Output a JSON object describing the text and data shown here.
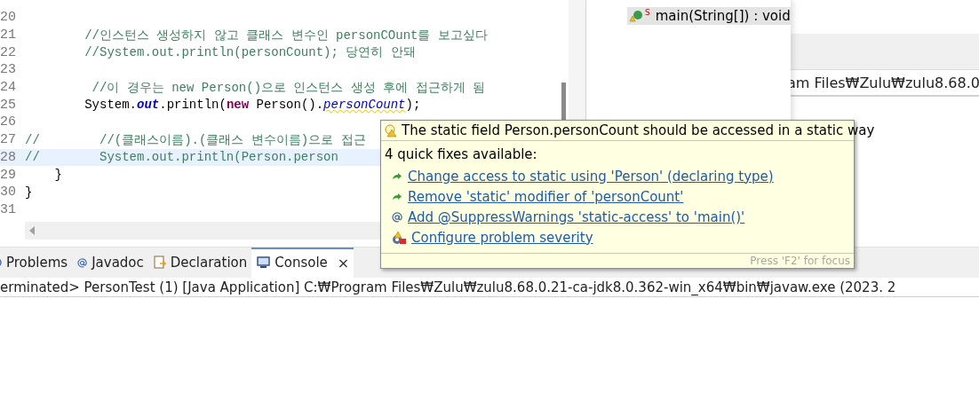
{
  "editor": {
    "lines": [
      {
        "number": "20",
        "highlighted": false
      },
      {
        "number": "21",
        "highlighted": false,
        "tokens": [
          {
            "text": "        //인스턴스 생성하지 않고 클래스 변수인 personCOunt를 보고싶다",
            "kind": "comment"
          }
        ]
      },
      {
        "number": "22",
        "highlighted": false,
        "tokens": [
          {
            "text": "        //System.out.println(personCount); 당연히 안돼",
            "kind": "comment"
          }
        ]
      },
      {
        "number": "23",
        "highlighted": false
      },
      {
        "number": "24",
        "highlighted": false,
        "tokens": [
          {
            "text": "         //이 경우는 new Person()으로 인스턴스 생성 후에 접근하게 됨",
            "kind": "comment"
          }
        ]
      },
      {
        "number": "25",
        "highlighted": false,
        "tokens": [
          {
            "text": "        System.",
            "kind": "plain"
          },
          {
            "text": "out",
            "kind": "static-field"
          },
          {
            "text": ".println(",
            "kind": "plain"
          },
          {
            "text": "new",
            "kind": "keyword"
          },
          {
            "text": " Person().",
            "kind": "plain"
          },
          {
            "text": "personCount",
            "kind": "warning-field"
          },
          {
            "text": ");",
            "kind": "plain"
          }
        ]
      },
      {
        "number": "26",
        "highlighted": false
      },
      {
        "number": "27",
        "highlighted": false,
        "tokens": [
          {
            "text": "//        //(클래스이름).(클래스 변수이름)으로 접근",
            "kind": "comment"
          }
        ]
      },
      {
        "number": "28",
        "highlighted": true,
        "tokens": [
          {
            "text": "//        System.out.println(Person.person",
            "kind": "comment"
          }
        ]
      },
      {
        "number": "29",
        "highlighted": false,
        "tokens": [
          {
            "text": "    }",
            "kind": "plain"
          }
        ]
      },
      {
        "number": "30",
        "highlighted": false,
        "tokens": [
          {
            "text": "}",
            "kind": "plain"
          }
        ]
      },
      {
        "number": "31",
        "highlighted": false
      }
    ]
  },
  "outline": {
    "items": [
      {
        "label": "main(String[]) : void",
        "modifier": "S",
        "selected": true
      }
    ]
  },
  "background_window": {
    "text": "am Files₩Zulu₩zulu8.68.0"
  },
  "bottom_tabs": [
    {
      "label": "Problems",
      "selected": false
    },
    {
      "label": "Javadoc",
      "selected": false
    },
    {
      "label": "Declaration",
      "selected": false
    },
    {
      "label": "Console",
      "selected": true,
      "close": "×"
    }
  ],
  "console": {
    "header": "erminated> PersonTest (1) [Java Application] C:₩Program Files₩Zulu₩zulu8.68.0.21-ca-jdk8.0.362-win_x64₩bin₩javaw.exe  (2023. 2"
  },
  "hover": {
    "title": "The static field Person.personCount should be accessed in a static way",
    "subtitle": "4 quick fixes available:",
    "fixes": [
      {
        "label": "Change access to static using 'Person' (declaring type)",
        "kind": "arrow"
      },
      {
        "label": "Remove 'static' modifier of 'personCount'",
        "kind": "arrow"
      },
      {
        "label": "Add @SuppressWarnings 'static-access' to 'main()'",
        "kind": "annotation"
      },
      {
        "label": "Configure problem severity",
        "kind": "configure"
      }
    ],
    "footer": "Press 'F2' for focus"
  }
}
